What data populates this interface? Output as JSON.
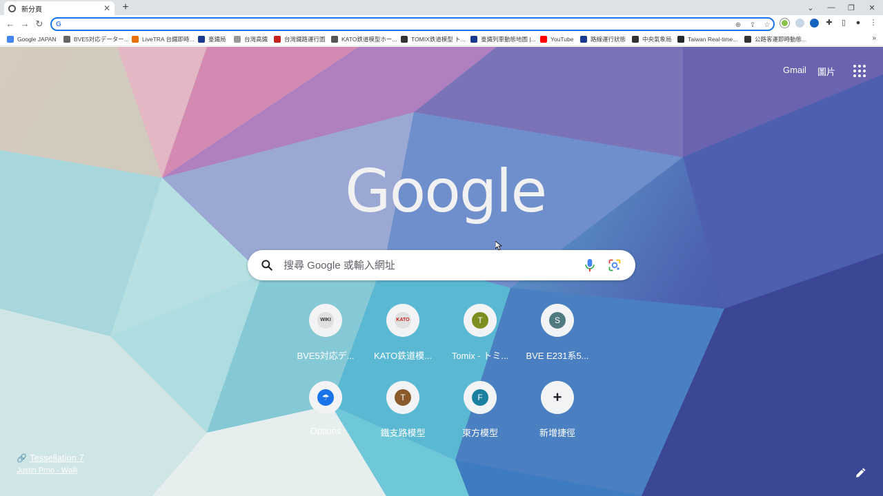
{
  "tab": {
    "title": "新分頁",
    "favicon": "chrome-icon"
  },
  "window": {
    "controls": [
      "chevron-down-icon",
      "minimize-icon",
      "restore-icon",
      "close-icon"
    ]
  },
  "omnibox": {
    "value": "",
    "prefix": "G"
  },
  "bookmarks": [
    {
      "label": "Google JAPAN",
      "icon_color": "#4285f4"
    },
    {
      "label": "BVE5対応データー...",
      "icon_color": "#666666"
    },
    {
      "label": "LiveTRA 台鐵即時...",
      "icon_color": "#e8710a"
    },
    {
      "label": "臺鐵局",
      "icon_color": "#1a3a8f"
    },
    {
      "label": "台灣高鐵",
      "icon_color": "#999999"
    },
    {
      "label": "台灣鐵路運行圖",
      "icon_color": "#c5221f"
    },
    {
      "label": "KATO鉄道模型ホー...",
      "icon_color": "#555555"
    },
    {
      "label": "TOMIX鉄道模型 ト...",
      "icon_color": "#333333"
    },
    {
      "label": "臺鐵列車動態地圖 |...",
      "icon_color": "#1a3a8f"
    },
    {
      "label": "YouTube",
      "icon_color": "#ff0000"
    },
    {
      "label": "路線運行狀態",
      "icon_color": "#1a3a8f"
    },
    {
      "label": "中央氣象局",
      "icon_color": "#333333"
    },
    {
      "label": "Taiwan Real-time...",
      "icon_color": "#24292e"
    },
    {
      "label": "公路客運即時動態...",
      "icon_color": "#333333"
    }
  ],
  "ntp": {
    "gmail": "Gmail",
    "images": "圖片",
    "logo": "Google",
    "search_placeholder": "搜尋 Google 或輸入網址",
    "shortcuts": [
      {
        "label": "BVE5対応デ...",
        "letter": "WIKI",
        "color": "#e0e0e0",
        "text_color": "#333333"
      },
      {
        "label": "KATO鉄道模...",
        "letter": "KATO",
        "color": "#e0e0e0",
        "text_color": "#c5221f"
      },
      {
        "label": "Tomix - トミ...",
        "letter": "T",
        "color": "#7a8f1f",
        "text_color": "#ffffff"
      },
      {
        "label": "BVE E231系5...",
        "letter": "S",
        "color": "#4f7a80",
        "text_color": "#ffffff"
      },
      {
        "label": "Options",
        "letter": "",
        "color": "#1a73e8",
        "text_color": "#ffffff"
      },
      {
        "label": "鐵支路模型",
        "letter": "T",
        "color": "#8a5a2b",
        "text_color": "#ffffff"
      },
      {
        "label": "東方模型",
        "letter": "F",
        "color": "#1a7fa0",
        "text_color": "#ffffff"
      },
      {
        "label": "新增捷徑",
        "letter": "+",
        "color": "#f1f3f4",
        "text_color": "#202124"
      }
    ],
    "credit_title": "Tessellation 7",
    "credit_author": "Justin Prno - Walli"
  }
}
